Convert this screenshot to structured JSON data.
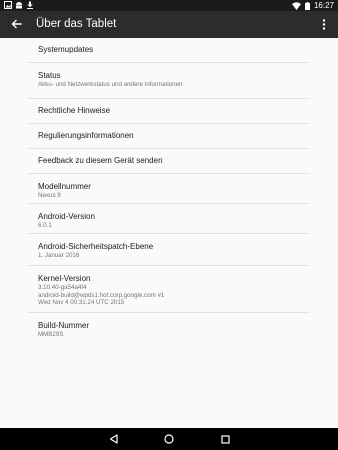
{
  "status_bar": {
    "time": "16:27",
    "left_icons": [
      "image-icon",
      "android-icon",
      "download-icon"
    ],
    "right_icons": [
      "wifi-icon",
      "battery-icon"
    ]
  },
  "app_bar": {
    "title": "Über das Tablet",
    "back_icon": "arrow-back-icon",
    "overflow_icon": "more-vert-icon"
  },
  "items": [
    {
      "title": "Systemupdates"
    },
    {
      "title": "Status",
      "summary": [
        "Akku- und Netzwerkstatus und andere Informationen"
      ]
    },
    {
      "title": "Rechtliche Hinweise"
    },
    {
      "title": "Regulierungsinformationen"
    },
    {
      "title": "Feedback zu diesem Gerät senden"
    },
    {
      "title": "Modellnummer",
      "summary": [
        "Nexus 9"
      ]
    },
    {
      "title": "Android-Version",
      "summary": [
        "6.0.1"
      ]
    },
    {
      "title": "Android-Sicherheitspatch-Ebene",
      "summary": [
        "1. Januar 2016"
      ]
    },
    {
      "title": "Kernel-Version",
      "summary": [
        "3.10.40-ga54a4f4",
        "android-build@wpds1.hot.corp.google.com #1",
        "Wed Nov 4 00:31:24 UTC 2015"
      ]
    },
    {
      "title": "Build-Nummer",
      "summary": [
        "MMB29S"
      ]
    }
  ],
  "nav_bar": {
    "icons": [
      "back-triangle-icon",
      "home-circle-icon",
      "recents-square-icon"
    ]
  }
}
